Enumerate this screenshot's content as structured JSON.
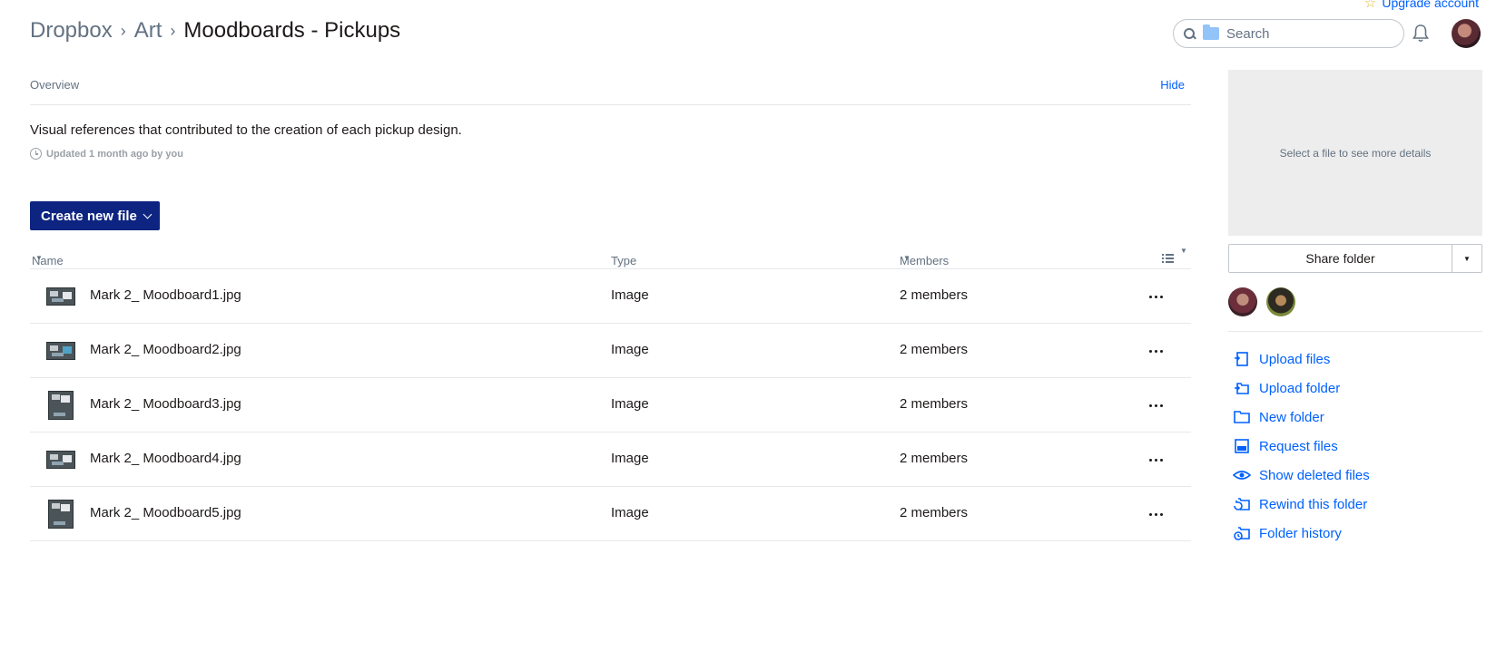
{
  "header": {
    "upgrade_label": "Upgrade account",
    "breadcrumb": [
      "Dropbox",
      "Art",
      "Moodboards - Pickups"
    ],
    "search_placeholder": "Search"
  },
  "overview": {
    "label": "Overview",
    "hide_label": "Hide",
    "description": "Visual references that contributed to the creation of each pickup design.",
    "updated": "Updated 1 month ago by you"
  },
  "create_button": "Create new file",
  "table": {
    "columns": {
      "name": "Name",
      "type": "Type",
      "members": "Members"
    },
    "rows": [
      {
        "name": "Mark 2_ Moodboard1.jpg",
        "type": "Image",
        "members": "2 members"
      },
      {
        "name": "Mark 2_ Moodboard2.jpg",
        "type": "Image",
        "members": "2 members"
      },
      {
        "name": "Mark 2_ Moodboard3.jpg",
        "type": "Image",
        "members": "2 members"
      },
      {
        "name": "Mark 2_ Moodboard4.jpg",
        "type": "Image",
        "members": "2 members"
      },
      {
        "name": "Mark 2_ Moodboard5.jpg",
        "type": "Image",
        "members": "2 members"
      }
    ]
  },
  "panel": {
    "details_placeholder": "Select a file to see more details",
    "share_label": "Share folder",
    "actions": [
      {
        "label": "Upload files",
        "icon": "upload-files-icon"
      },
      {
        "label": "Upload folder",
        "icon": "upload-folder-icon"
      },
      {
        "label": "New folder",
        "icon": "new-folder-icon"
      },
      {
        "label": "Request files",
        "icon": "request-files-icon"
      },
      {
        "label": "Show deleted files",
        "icon": "eye-icon"
      },
      {
        "label": "Rewind this folder",
        "icon": "rewind-icon"
      },
      {
        "label": "Folder history",
        "icon": "history-icon"
      }
    ]
  },
  "colors": {
    "accent": "#0061fe",
    "primary_button": "#0d2481",
    "text": "#1e1919",
    "muted": "#637282"
  }
}
